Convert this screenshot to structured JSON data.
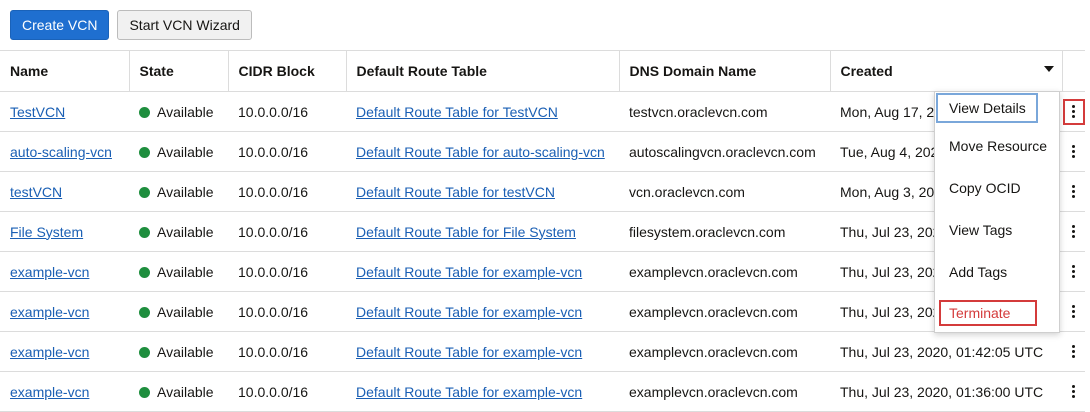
{
  "toolbar": {
    "create_label": "Create VCN",
    "wizard_label": "Start VCN Wizard"
  },
  "table": {
    "headers": [
      "Name",
      "State",
      "CIDR Block",
      "Default Route Table",
      "DNS Domain Name",
      "Created"
    ],
    "rows": [
      {
        "name": "TestVCN",
        "state": "Available",
        "cidr": "10.0.0.0/16",
        "route_table": "Default Route Table for TestVCN",
        "dns": "testvcn.oraclevcn.com",
        "created": "Mon, Aug 17, 2020, 08:13:47 UTC"
      },
      {
        "name": "auto-scaling-vcn",
        "state": "Available",
        "cidr": "10.0.0.0/16",
        "route_table": "Default Route Table for auto-scaling-vcn",
        "dns": "autoscalingvcn.oraclevcn.com",
        "created": "Tue, Aug 4, 2020, 10:26:55 UTC"
      },
      {
        "name": "testVCN",
        "state": "Available",
        "cidr": "10.0.0.0/16",
        "route_table": "Default Route Table for testVCN",
        "dns": "vcn.oraclevcn.com",
        "created": "Mon, Aug 3, 2020, 07:40:12 UTC"
      },
      {
        "name": "File System",
        "state": "Available",
        "cidr": "10.0.0.0/16",
        "route_table": "Default Route Table for File System",
        "dns": "filesystem.oraclevcn.com",
        "created": "Thu, Jul 23, 2020, 02:01:30 UTC"
      },
      {
        "name": "example-vcn",
        "state": "Available",
        "cidr": "10.0.0.0/16",
        "route_table": "Default Route Table for example-vcn",
        "dns": "examplevcn.oraclevcn.com",
        "created": "Thu, Jul 23, 2020, 01:55:18 UTC"
      },
      {
        "name": "example-vcn",
        "state": "Available",
        "cidr": "10.0.0.0/16",
        "route_table": "Default Route Table for example-vcn",
        "dns": "examplevcn.oraclevcn.com",
        "created": "Thu, Jul 23, 2020, 01:48:41 UTC"
      },
      {
        "name": "example-vcn",
        "state": "Available",
        "cidr": "10.0.0.0/16",
        "route_table": "Default Route Table for example-vcn",
        "dns": "examplevcn.oraclevcn.com",
        "created": "Thu, Jul 23, 2020, 01:42:05 UTC"
      },
      {
        "name": "example-vcn",
        "state": "Available",
        "cidr": "10.0.0.0/16",
        "route_table": "Default Route Table for example-vcn",
        "dns": "examplevcn.oraclevcn.com",
        "created": "Thu, Jul 23, 2020, 01:36:00 UTC"
      }
    ]
  },
  "menu": {
    "items": [
      "View Details",
      "Move Resource",
      "Copy OCID",
      "View Tags",
      "Add Tags",
      "Terminate"
    ]
  },
  "icons": {
    "sort": "caret-down-icon",
    "row_actions": "kebab-icon",
    "status": "status-dot-icon"
  },
  "colors": {
    "primary": "#1f6fd0",
    "link": "#1a5fb4",
    "available": "#1e8e3e",
    "danger": "#d43b3b"
  }
}
